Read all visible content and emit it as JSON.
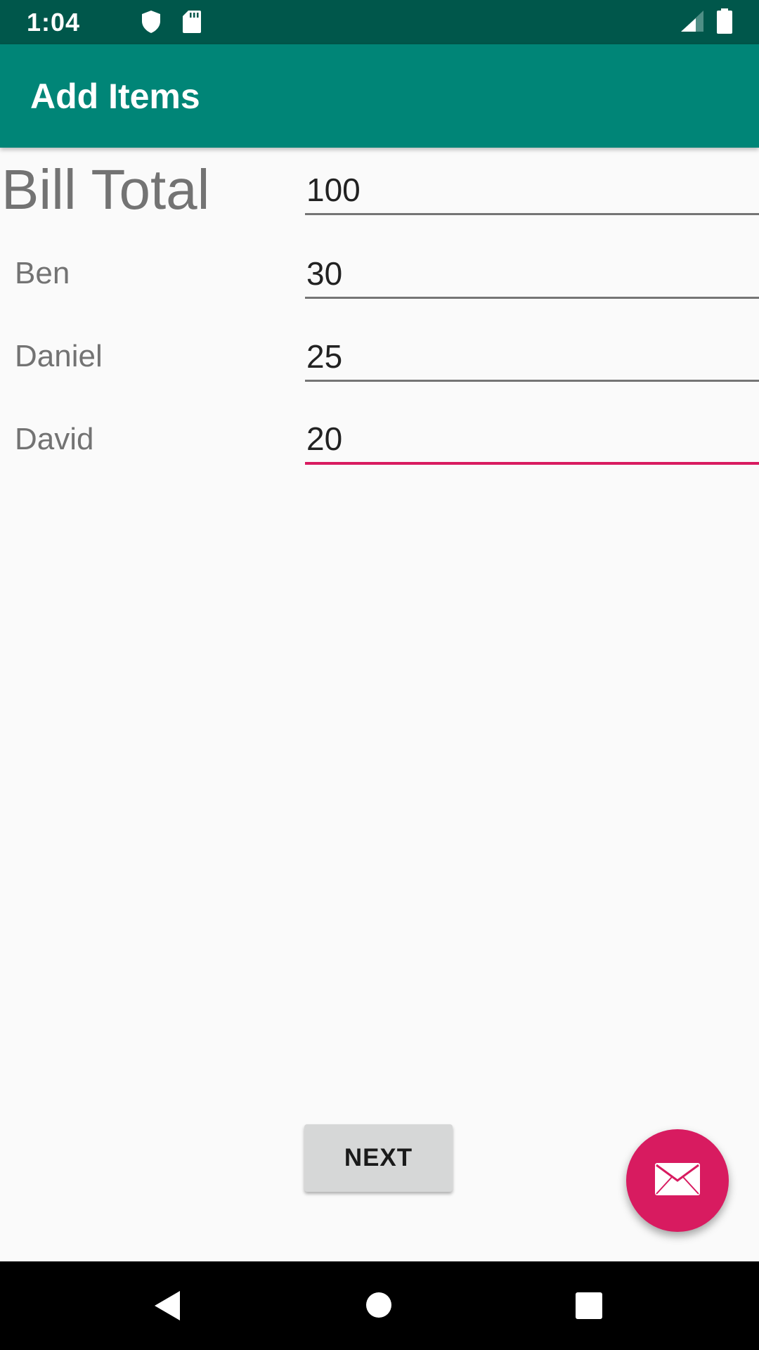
{
  "status_bar": {
    "time": "1:04",
    "icons": [
      "shield-icon",
      "sd-card-icon",
      "signal-icon",
      "battery-icon"
    ]
  },
  "app_bar": {
    "title": "Add Items"
  },
  "form": {
    "rows": [
      {
        "label": "Bill Total",
        "value": "100"
      },
      {
        "label": "Ben",
        "value": "30"
      },
      {
        "label": "Daniel",
        "value": "25"
      },
      {
        "label": "David",
        "value": "20"
      }
    ],
    "focused_index": 3
  },
  "next_button": {
    "label": "NEXT"
  },
  "fab": {
    "icon": "mail-icon"
  },
  "nav_bar": {
    "icons": [
      "back-icon",
      "home-icon",
      "recents-icon"
    ]
  },
  "colors": {
    "status_bar": "#00574b",
    "app_bar": "#008577",
    "accent": "#d81b60",
    "background": "#fafafa"
  }
}
